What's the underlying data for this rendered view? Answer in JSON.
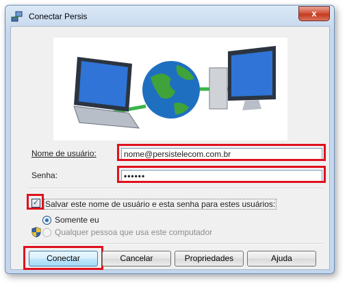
{
  "window": {
    "title": "Conectar Persis",
    "close_glyph": "x"
  },
  "form": {
    "username_label": "Nome de usuário:",
    "username_value": "nome@persistelecom.com.br",
    "password_label": "Senha:",
    "password_value": "••••••",
    "save_label": "Salvar este nome de usuário e esta senha para estes usuários:",
    "save_checked": true,
    "option_me": "Somente eu",
    "option_anyone": "Qualquer pessoa que usa este computador"
  },
  "buttons": {
    "connect": "Conectar",
    "cancel": "Cancelar",
    "properties": "Propriedades",
    "help": "Ajuda"
  },
  "icons": [
    "network-connection-icon",
    "laptop-illustration",
    "globe-illustration",
    "monitor-illustration",
    "uac-shield-icon"
  ],
  "colors": {
    "highlight": "#e0101c",
    "title_bg": "#c4d7ee"
  }
}
